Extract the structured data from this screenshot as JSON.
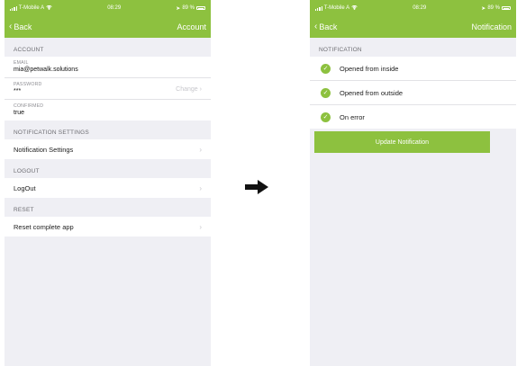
{
  "colors": {
    "accent": "#8dc13f",
    "background": "#efeff4"
  },
  "left": {
    "status": {
      "carrier": "T-Mobile A",
      "time": "08:29",
      "battery": "89 %"
    },
    "nav": {
      "back": "Back",
      "title": "Account"
    },
    "account_header": "ACCOUNT",
    "email": {
      "label": "EMAIL",
      "value": "mia@petwalk.solutions"
    },
    "password": {
      "label": "PASSWORD",
      "value": "***",
      "action": "Change"
    },
    "confirmed": {
      "label": "CONFIRMED",
      "value": "true"
    },
    "notification_header": "NOTIFICATION SETTINGS",
    "notification_row": "Notification Settings",
    "logout_header": "LOGOUT",
    "logout_row": "LogOut",
    "reset_header": "RESET",
    "reset_row": "Reset complete app"
  },
  "right": {
    "status": {
      "carrier": "T-Mobile A",
      "time": "08:29",
      "battery": "89 %"
    },
    "nav": {
      "back": "Back",
      "title": "Notification"
    },
    "notification_header": "NOTIFICATION",
    "options": [
      {
        "label": "Opened from inside",
        "checked": true
      },
      {
        "label": "Opened from outside",
        "checked": true
      },
      {
        "label": "On error",
        "checked": true
      }
    ],
    "update_button": "Update Notification"
  },
  "icons": {
    "transition": "arrow-right-icon",
    "check": "check-icon",
    "wifi": "wifi-icon",
    "back": "chevron-left-icon",
    "disclosure": "chevron-right-icon"
  }
}
